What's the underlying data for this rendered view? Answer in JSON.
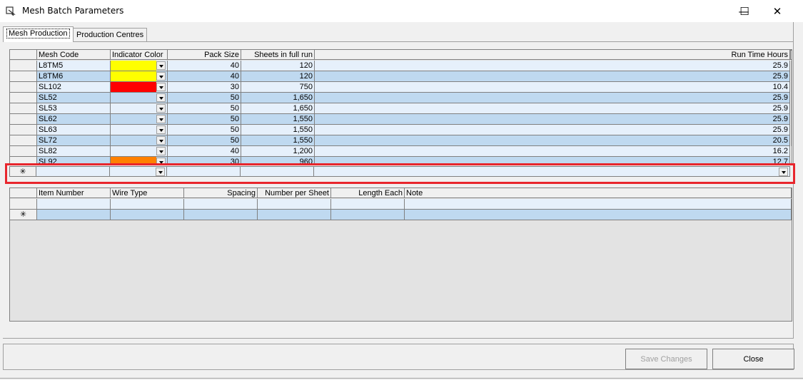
{
  "window": {
    "title": "Mesh Batch Parameters",
    "minimize_glyph": "—",
    "maximize_glyph": "☐",
    "close_glyph": "✕"
  },
  "tabs": [
    {
      "label": "Mesh Production",
      "active": true
    },
    {
      "label": "Production Centres",
      "active": false
    }
  ],
  "mesh_grid": {
    "columns": [
      "Mesh Code",
      "Indicator Color",
      "Pack Size",
      "Sheets in full run",
      "Run Time Hours"
    ],
    "rows": [
      {
        "code": "L8TM5",
        "color": "#ffff00",
        "pack": "40",
        "sheets": "120",
        "hours": "25.9"
      },
      {
        "code": "L8TM6",
        "color": "#ffff00",
        "pack": "40",
        "sheets": "120",
        "hours": "25.9"
      },
      {
        "code": "SL102",
        "color": "#ff0000",
        "pack": "30",
        "sheets": "750",
        "hours": "10.4"
      },
      {
        "code": "SL52",
        "color": "",
        "pack": "50",
        "sheets": "1,650",
        "hours": "25.9"
      },
      {
        "code": "SL53",
        "color": "",
        "pack": "50",
        "sheets": "1,650",
        "hours": "25.9"
      },
      {
        "code": "SL62",
        "color": "",
        "pack": "50",
        "sheets": "1,550",
        "hours": "25.9"
      },
      {
        "code": "SL63",
        "color": "",
        "pack": "50",
        "sheets": "1,550",
        "hours": "25.9"
      },
      {
        "code": "SL72",
        "color": "",
        "pack": "50",
        "sheets": "1,550",
        "hours": "20.5"
      },
      {
        "code": "SL82",
        "color": "",
        "pack": "40",
        "sheets": "1,200",
        "hours": "16.2"
      },
      {
        "code": "SL92",
        "color": "#ff8000",
        "pack": "30",
        "sheets": "960",
        "hours": "12.7"
      }
    ],
    "new_row_marker": "✳"
  },
  "detail_grid": {
    "columns": [
      "Item Number",
      "Wire Type",
      "Spacing",
      "Number per Sheet",
      "Length Each",
      "Note"
    ],
    "new_row_marker": "✳"
  },
  "buttons": {
    "save_label": "Save Changes",
    "close_label": "Close"
  }
}
